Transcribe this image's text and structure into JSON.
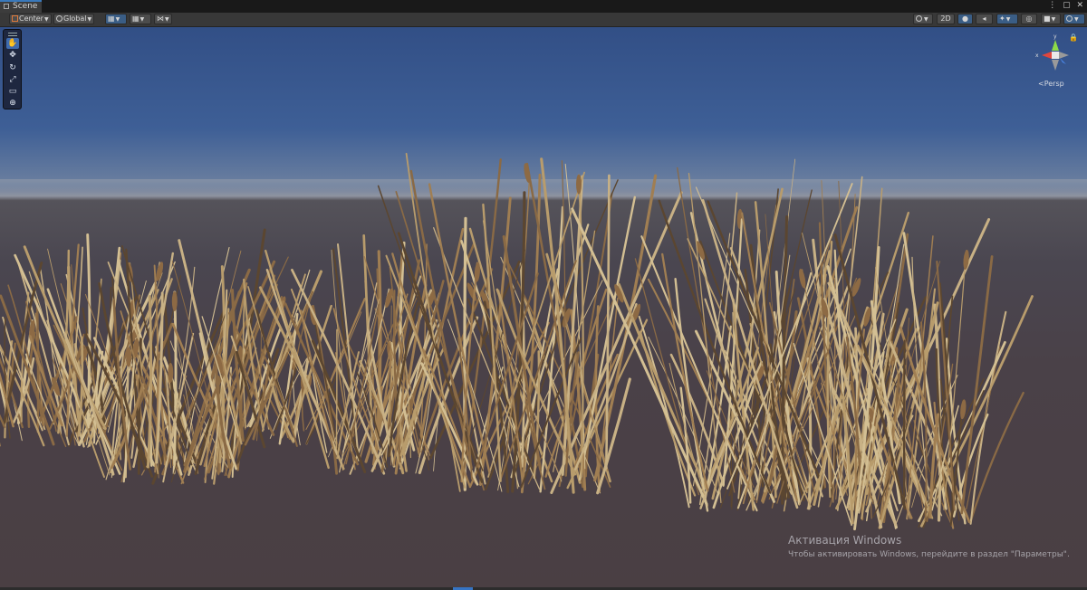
{
  "window": {
    "tab_label": "Scene",
    "controls": [
      "⋮",
      "▢",
      "✕"
    ]
  },
  "toolbar": {
    "pivot_label": "Center",
    "space_label": "Global",
    "mode_2d_label": "2D"
  },
  "tools": [
    "hand",
    "move",
    "rotate",
    "scale",
    "rect",
    "transform"
  ],
  "gizmo": {
    "view_label": "Persp",
    "y_axis_label": "y",
    "x_axis_label": "x",
    "colors": {
      "x": "#e0463d",
      "y": "#8ddb48",
      "z": "#4a87e8"
    }
  },
  "watermark": {
    "title": "Активация Windows",
    "subtitle": "Чтобы активировать Windows, перейдите в раздел \"Параметры\"."
  },
  "colors": {
    "sky_top": "#324f86",
    "horizon": "#8e93a0",
    "ground": "#4a3f43",
    "grass_light": "#c8b185",
    "grass_dark": "#5b4630",
    "accent_blue": "#3a79bb"
  }
}
